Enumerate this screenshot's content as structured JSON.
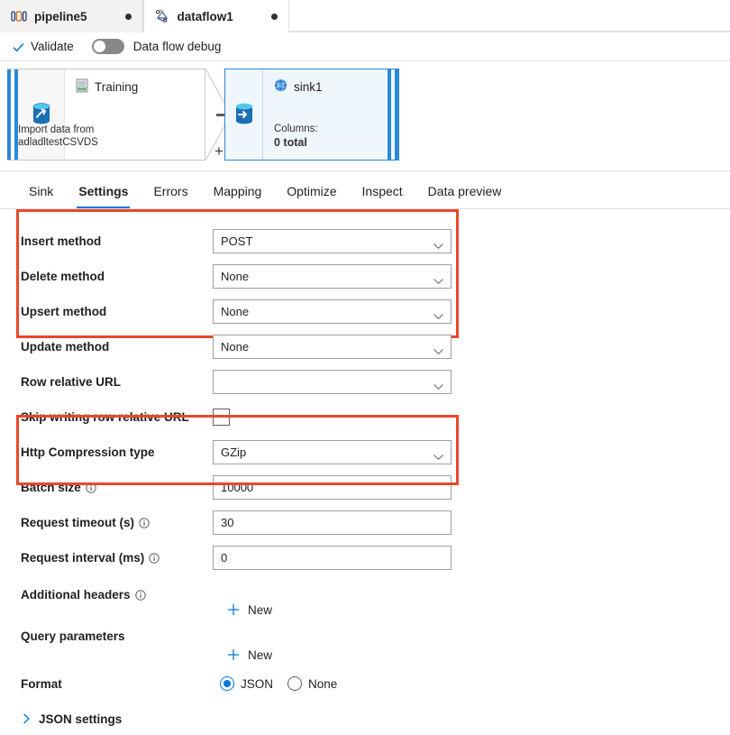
{
  "tabs": [
    {
      "label": "pipeline5",
      "icon": "pipeline-icon",
      "active": false
    },
    {
      "label": "dataflow1",
      "icon": "dataflow-icon",
      "active": true
    }
  ],
  "command_bar": {
    "validate_label": "Validate",
    "debug_toggle_label": "Data flow debug",
    "debug_toggle_state": "off"
  },
  "canvas": {
    "source_node": {
      "title": "Training",
      "description": "Import data from\nadladltestCSVDS",
      "desc_line1": "Import data from",
      "desc_line2": "adladltestCSVDS"
    },
    "sink_node": {
      "title": "sink1",
      "columns_label": "Columns:",
      "columns_value": "0 total"
    },
    "add_node_symbol": "+"
  },
  "panel_tabs": [
    {
      "label": "Sink",
      "active": false
    },
    {
      "label": "Settings",
      "active": true
    },
    {
      "label": "Errors",
      "active": false
    },
    {
      "label": "Mapping",
      "active": false
    },
    {
      "label": "Optimize",
      "active": false
    },
    {
      "label": "Inspect",
      "active": false
    },
    {
      "label": "Data preview",
      "active": false
    }
  ],
  "settings": {
    "insert_method": {
      "label": "Insert method",
      "value": "POST"
    },
    "delete_method": {
      "label": "Delete method",
      "value": "None"
    },
    "upsert_method": {
      "label": "Upsert method",
      "value": "None"
    },
    "update_method": {
      "label": "Update method",
      "value": "None"
    },
    "row_relative_url": {
      "label": "Row relative URL",
      "value": ""
    },
    "skip_writing_row_relative_url": {
      "label": "Skip writing row relative URL",
      "checked": false
    },
    "http_compression_type": {
      "label": "Http Compression type",
      "value": "GZip"
    },
    "batch_size": {
      "label": "Batch size",
      "value": "10000"
    },
    "request_timeout": {
      "label": "Request timeout (s)",
      "value": "30"
    },
    "request_interval": {
      "label": "Request interval (ms)",
      "value": "0"
    },
    "additional_headers": {
      "label": "Additional headers",
      "new_label": "New"
    },
    "query_parameters": {
      "label": "Query parameters",
      "new_label": "New"
    },
    "format": {
      "label": "Format",
      "options": [
        {
          "label": "JSON",
          "selected": true
        },
        {
          "label": "None",
          "selected": false
        }
      ]
    },
    "json_settings": {
      "label": "JSON settings",
      "expanded": false
    }
  },
  "colors": {
    "accent": "#0078d4",
    "highlight_box": "#e8482c",
    "node_selected": "#2b88d8",
    "sink_fill": "#eff6fc"
  }
}
